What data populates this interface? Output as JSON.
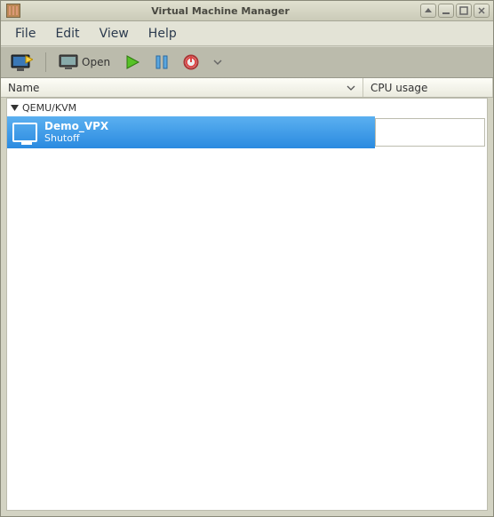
{
  "window": {
    "title": "Virtual Machine Manager"
  },
  "menu": {
    "file": "File",
    "edit": "Edit",
    "view": "View",
    "help": "Help"
  },
  "toolbar": {
    "open_label": "Open"
  },
  "columns": {
    "name": "Name",
    "cpu": "CPU usage"
  },
  "tree": {
    "group": "QEMU/KVM",
    "vms": [
      {
        "name": "Demo_VPX",
        "state": "Shutoff"
      }
    ]
  }
}
